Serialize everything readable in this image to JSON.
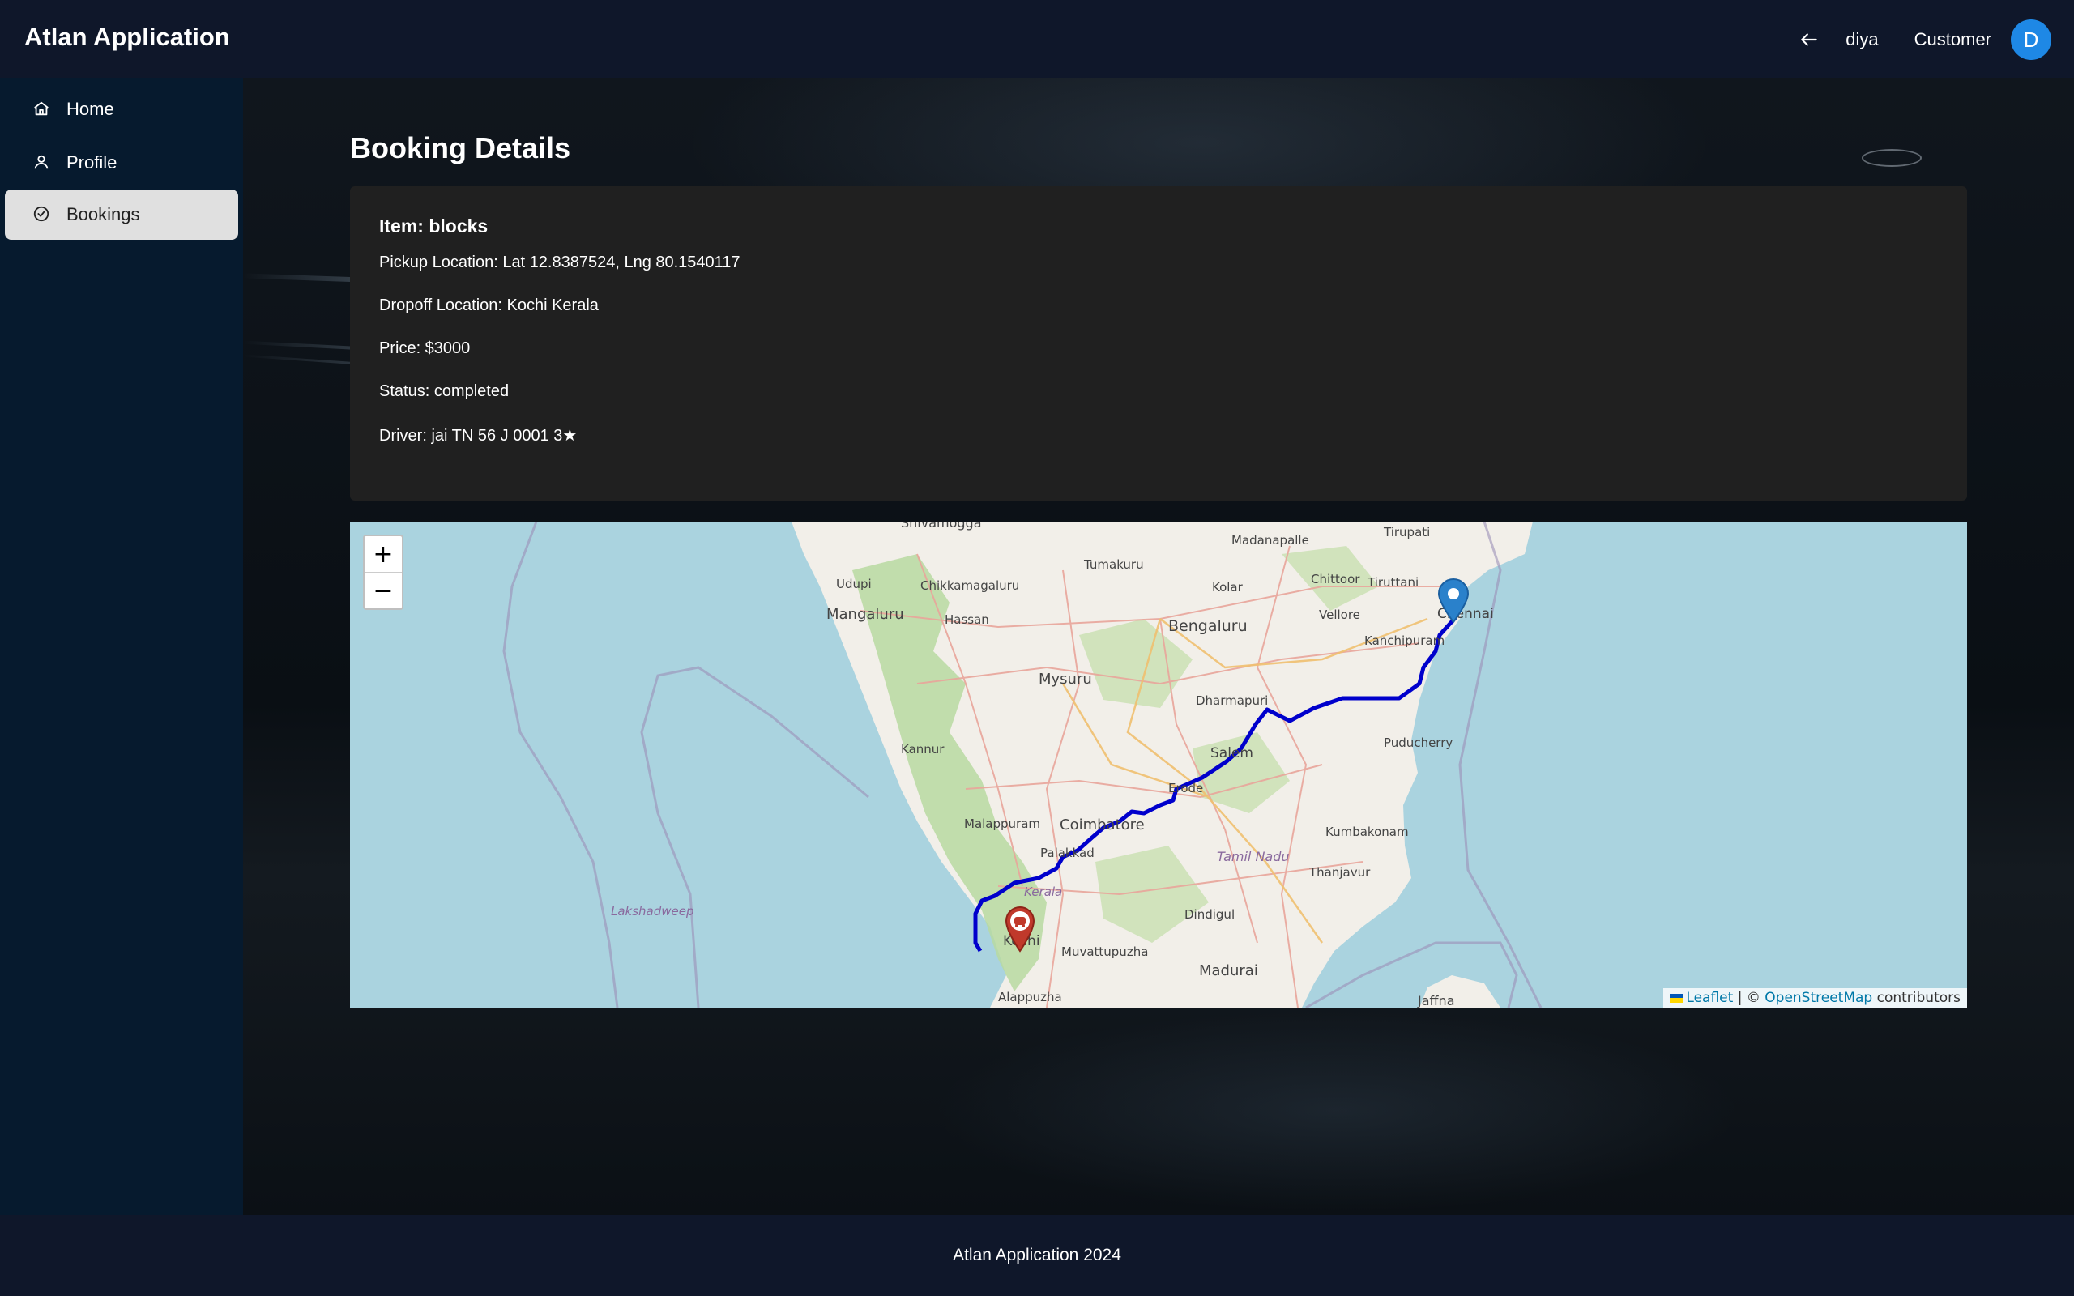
{
  "header": {
    "title": "Atlan Application",
    "user_name": "diya",
    "user_role": "Customer",
    "avatar_initial": "D"
  },
  "sidebar": {
    "items": [
      {
        "label": "Home",
        "icon": "home-icon"
      },
      {
        "label": "Profile",
        "icon": "user-icon"
      },
      {
        "label": "Bookings",
        "icon": "check-circle-icon",
        "active": true
      }
    ]
  },
  "page": {
    "title": "Booking Details"
  },
  "booking": {
    "item": "Item: blocks",
    "pickup": "Pickup Location: Lat 12.8387524, Lng 80.1540117",
    "dropoff": "Dropoff Location: Kochi Kerala",
    "price": "Price: $3000",
    "status": "Status: completed",
    "driver": "Driver: jai TN 56 J 0001 3★"
  },
  "map": {
    "zoom_in": "+",
    "zoom_out": "−",
    "route_color": "#0000cc",
    "pickup_marker_color": "#2a81cb",
    "dropoff_marker_color": "#c0392b",
    "labels": {
      "mangaluru": "Mangaluru",
      "udupi": "Udupi",
      "chikkamagaluru": "Chikkamagaluru",
      "tumakuru": "Tumakuru",
      "madanapalle": "Madanapalle",
      "tirupati": "Tirupati",
      "hassan": "Hassan",
      "bengaluru": "Bengaluru",
      "kolar": "Kolar",
      "chittoor": "Chittoor",
      "tiruttani": "Tiruttani",
      "vellore": "Vellore",
      "chennai": "Chennai",
      "kanchipuram": "Kanchipuram",
      "mysuru": "Mysuru",
      "dharmapuri": "Dharmapuri",
      "puducherry": "Puducherry",
      "kannur": "Kannur",
      "salem": "Salem",
      "erode": "Erode",
      "malappuram": "Malappuram",
      "coimbatore": "Coimbatore",
      "kumbakonam": "Kumbakonam",
      "palakkad": "Palakkad",
      "tamil_nadu": "Tamil Nadu",
      "thanjavur": "Thanjavur",
      "kerala": "Kerala",
      "lakshadweep": "Lakshadweep",
      "dindigul": "Dindigul",
      "kochi": "Kochi",
      "muvattupuzha": "Muvattupuzha",
      "madurai": "Madurai",
      "alappuzha": "Alappuzha",
      "jaffna": "Jaffna",
      "shivamogga": "Shivamogga"
    },
    "attribution": {
      "leaflet": "Leaflet",
      "separator": " | © ",
      "osm": "OpenStreetMap",
      "contributors": " contributors"
    }
  },
  "footer": {
    "text": "Atlan Application 2024"
  }
}
